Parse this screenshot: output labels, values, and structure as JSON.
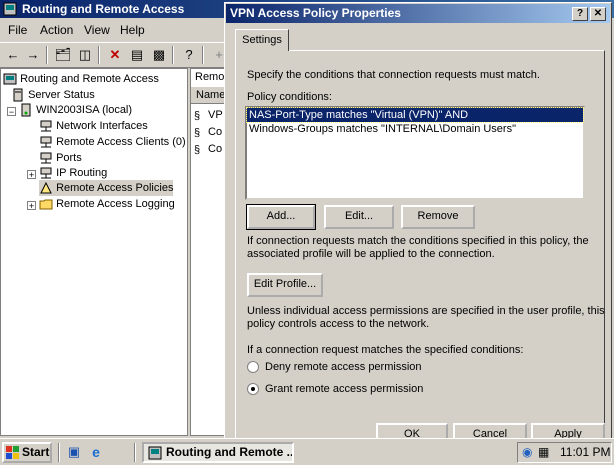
{
  "main_window": {
    "title": "Routing and Remote Access",
    "menu": [
      "File",
      "Action",
      "View",
      "Help"
    ],
    "list_column_header": "Name",
    "list_header_bar": "Remo",
    "list_items": [
      "VP",
      "Co",
      "Co"
    ]
  },
  "tree": {
    "root": "Routing and Remote Access",
    "items": [
      {
        "label": "Server Status",
        "icon": "server-status-icon"
      },
      {
        "label": "WIN2003ISA (local)",
        "icon": "server-icon"
      },
      {
        "label": "Network Interfaces",
        "icon": "network-icon"
      },
      {
        "label": "Remote Access Clients (0)",
        "icon": "clients-icon"
      },
      {
        "label": "Ports",
        "icon": "ports-icon"
      },
      {
        "label": "IP Routing",
        "icon": "routing-icon"
      },
      {
        "label": "Remote Access Policies",
        "icon": "policy-icon"
      },
      {
        "label": "Remote Access Logging",
        "icon": "folder-icon"
      }
    ]
  },
  "dialog": {
    "title": "VPN Access Policy Properties",
    "tab": "Settings",
    "intro": "Specify the conditions that connection requests must match.",
    "conditions_label": "Policy conditions:",
    "conditions": [
      "NAS-Port-Type matches \"Virtual (VPN)\" AND",
      "Windows-Groups matches \"INTERNAL\\Domain Users\""
    ],
    "add_button": "Add...",
    "edit_button": "Edit...",
    "remove_button": "Remove",
    "match_text_1": "If connection requests match the conditions specified in this policy, the",
    "match_text_2": "associated profile will be applied to the connection.",
    "edit_profile_button": "Edit Profile...",
    "perm_text_1": "Unless individual access permissions are specified in the user profile, this",
    "perm_text_2": "policy controls access to the network.",
    "request_text": "If a connection request matches the specified conditions:",
    "deny_label": "Deny remote access permission",
    "grant_label": "Grant remote access permission",
    "selected_permission": "grant",
    "ok_button": "OK",
    "cancel_button": "Cancel",
    "apply_button": "Apply"
  },
  "taskbar": {
    "start": "Start",
    "task": "Routing and Remote ...",
    "clock": "11:01 PM"
  }
}
